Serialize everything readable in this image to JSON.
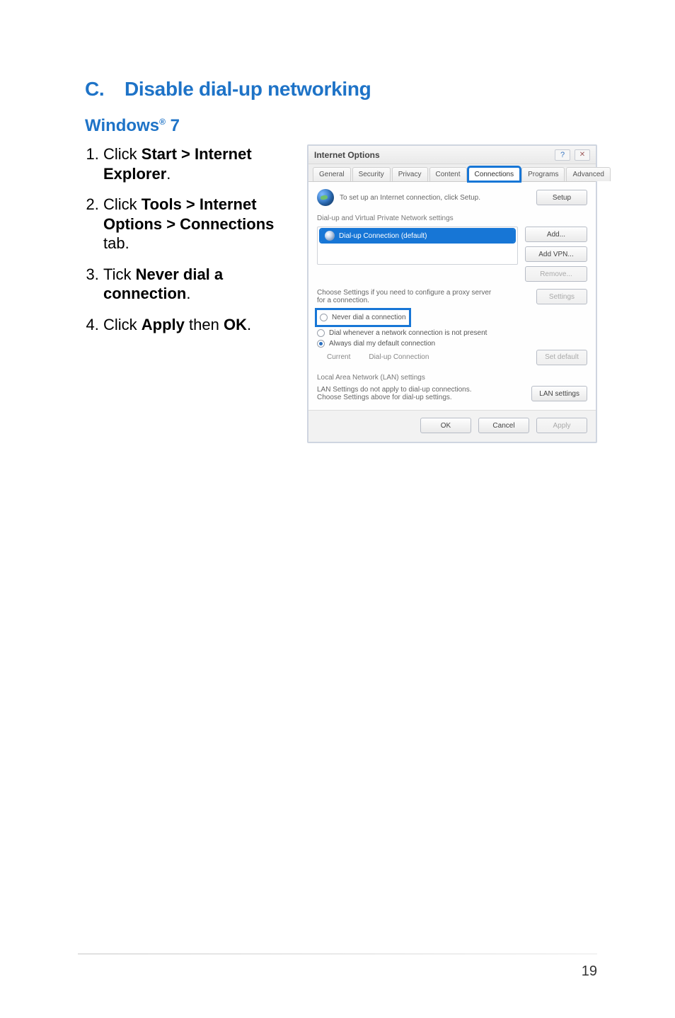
{
  "heading": {
    "letter": "C.",
    "title": "Disable dial-up networking"
  },
  "os": {
    "name": "Windows",
    "suffix": "7",
    "reg": "®"
  },
  "steps": [
    {
      "pre": "Click ",
      "b1": "Start > Internet Explorer",
      "post": "."
    },
    {
      "pre": "Click ",
      "b1": "Tools > Internet Options > Connections",
      "post": " tab."
    },
    {
      "pre": "Tick ",
      "b1": "Never dial a connection",
      "post": "."
    },
    {
      "pre": "Click ",
      "b1": "Apply",
      "mid": " then ",
      "b2": "OK",
      "post": "."
    }
  ],
  "dialog": {
    "title": "Internet Options",
    "tabs": [
      "General",
      "Security",
      "Privacy",
      "Content",
      "Connections",
      "Programs",
      "Advanced"
    ],
    "activeTab": "Connections",
    "setupText": "To set up an Internet connection, click Setup.",
    "setupBtn": "Setup",
    "dunHeader": "Dial-up and Virtual Private Network settings",
    "listItem": "Dial-up Connection (default)",
    "addBtn": "Add...",
    "addVpnBtn": "Add VPN...",
    "removeBtn": "Remove...",
    "chooseText": "Choose Settings if you need to configure a proxy server for a connection.",
    "settingsBtn": "Settings",
    "radioNever": "Never dial a connection",
    "radioWhenever": "Dial whenever a network connection is not present",
    "radioAlways": "Always dial my default connection",
    "currentLabel": "Current",
    "currentValue": "Dial-up Connection",
    "setDefaultBtn": "Set default",
    "lanHeader": "Local Area Network (LAN) settings",
    "lanText": "LAN Settings do not apply to dial-up connections. Choose Settings above for dial-up settings.",
    "lanBtn": "LAN settings",
    "ok": "OK",
    "cancel": "Cancel",
    "apply": "Apply"
  },
  "pageNumber": "19"
}
